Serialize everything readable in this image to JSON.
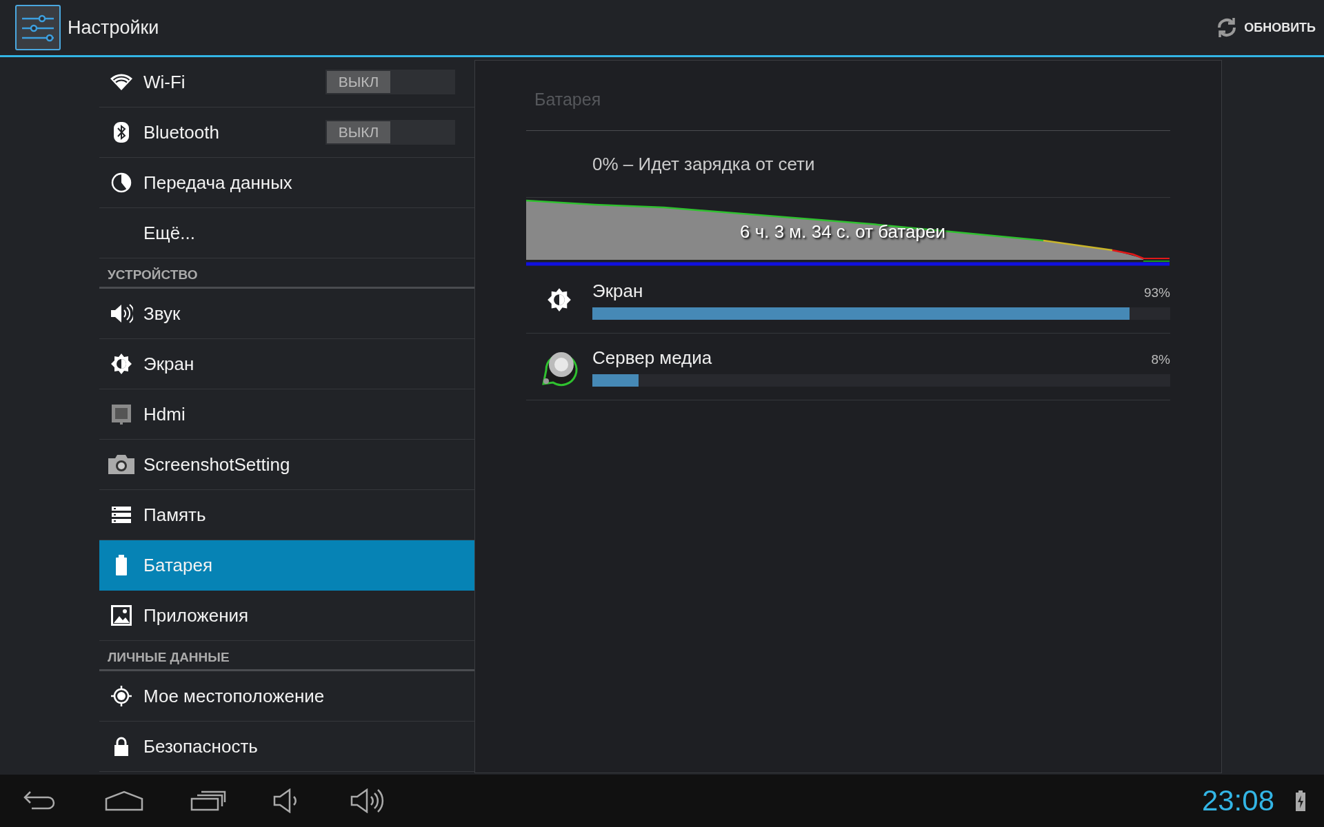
{
  "action_bar": {
    "title": "Настройки",
    "action": "ОБНОВИТЬ"
  },
  "sidebar": {
    "items": [
      {
        "kind": "toggle",
        "label": "Wi-Fi",
        "toggle": "ВЫКЛ",
        "on": false,
        "selected": false
      },
      {
        "kind": "toggle",
        "label": "Bluetooth",
        "toggle": "ВЫКЛ",
        "on": false,
        "selected": false
      },
      {
        "kind": "item",
        "label": "Передача данных",
        "selected": false
      },
      {
        "kind": "item",
        "label": "Ещё...",
        "selected": false
      },
      {
        "kind": "header",
        "label": "УСТРОЙСТВО"
      },
      {
        "kind": "item",
        "label": "Звук",
        "selected": false
      },
      {
        "kind": "item",
        "label": "Экран",
        "selected": false
      },
      {
        "kind": "item",
        "label": "Hdmi",
        "selected": false
      },
      {
        "kind": "item",
        "label": "ScreenshotSetting",
        "selected": false
      },
      {
        "kind": "item",
        "label": "Память",
        "selected": false
      },
      {
        "kind": "item",
        "label": "Батарея",
        "selected": true
      },
      {
        "kind": "item",
        "label": "Приложения",
        "selected": false
      },
      {
        "kind": "header",
        "label": "ЛИЧНЫЕ ДАННЫЕ"
      },
      {
        "kind": "item",
        "label": "Мое местоположение",
        "selected": false
      },
      {
        "kind": "item",
        "label": "Безопасность",
        "selected": false
      }
    ]
  },
  "battery": {
    "title": "Батарея",
    "status": "0% – Идет зарядка от сети",
    "graph_label": "6 ч. 3 м. 34 с. от батареи",
    "usage": [
      {
        "name": "Экран",
        "percent": "93%",
        "level": 0.93
      },
      {
        "name": "Сервер медиа",
        "percent": "8%",
        "level": 0.08
      }
    ]
  },
  "nav_bar": {
    "time": "23:08"
  }
}
